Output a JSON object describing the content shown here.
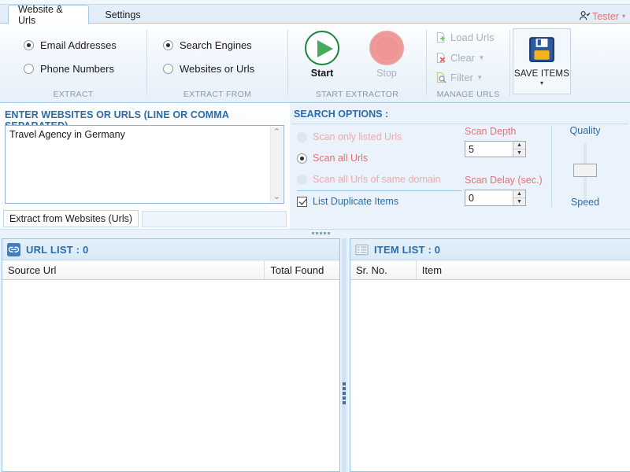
{
  "window": {
    "tabs": [
      {
        "label": "Website & Urls",
        "active": true
      },
      {
        "label": "Settings",
        "active": false
      }
    ],
    "user": {
      "name": "Tester",
      "icon": "user-check-icon",
      "caret": "▾",
      "color": "#e27272"
    }
  },
  "ribbon": {
    "groups": [
      {
        "name": "extract",
        "label": "EXTRACT",
        "options": [
          {
            "label": "Email Addresses",
            "selected": true
          },
          {
            "label": "Phone Numbers",
            "selected": false
          }
        ]
      },
      {
        "name": "extract-from",
        "label": "EXTRACT FROM",
        "options": [
          {
            "label": "Search Engines",
            "selected": true
          },
          {
            "label": "Websites or Urls",
            "selected": false
          }
        ]
      },
      {
        "name": "start-extractor",
        "label": "START EXTRACTOR",
        "buttons": [
          {
            "label": "Start",
            "icon": "play-circle-icon",
            "enabled": true
          },
          {
            "label": "Stop",
            "icon": "stop-circle-icon",
            "enabled": false
          }
        ]
      },
      {
        "name": "manage-urls",
        "label": "MANAGE URLS",
        "buttons": [
          {
            "label": "Load Urls",
            "icon": "page-plus-icon",
            "enabled": false,
            "caret": ""
          },
          {
            "label": "Clear",
            "icon": "page-x-icon",
            "enabled": false,
            "caret": "▾"
          },
          {
            "label": "Filter",
            "icon": "page-search-icon",
            "enabled": false,
            "caret": "▾"
          }
        ]
      }
    ],
    "save_items": {
      "label": "SAVE ITEMS",
      "icon": "floppy-disk-icon",
      "caret": "▾"
    }
  },
  "urls_panel": {
    "title": "ENTER WEBSITES OR URLS (LINE OR COMMA SEPARATED)",
    "textarea_value": "Travel Agency in Germany",
    "textarea_placeholder": "",
    "scroll_up": "⌃",
    "scroll_down": "⌄",
    "tab_label": "Extract from Websites (Urls)"
  },
  "search_options": {
    "title": "SEARCH OPTIONS :",
    "scan_modes": [
      {
        "label": "Scan only listed Urls",
        "selected": false,
        "enabled": false
      },
      {
        "label": "Scan all Urls",
        "selected": true,
        "enabled": true
      },
      {
        "label": "Scan all Urls of same domain",
        "selected": false,
        "enabled": false
      }
    ],
    "list_duplicate": {
      "label": "List Duplicate Items",
      "checked": true
    },
    "scan_depth": {
      "label": "Scan Depth",
      "value": "5"
    },
    "scan_delay": {
      "label": "Scan Delay (sec.)",
      "value": "0"
    },
    "slider": {
      "top_label": "Quality",
      "bottom_label": "Speed",
      "position": "middle"
    }
  },
  "url_list": {
    "header": "URL LIST : 0",
    "icon": "link-icon",
    "columns": [
      "Source Url",
      "Total Found"
    ],
    "rows": []
  },
  "item_list": {
    "header": "ITEM LIST : 0",
    "icon": "table-grid-icon",
    "columns": [
      "Sr. No.",
      "Item"
    ],
    "rows": []
  },
  "annotation": {
    "shape": "left-arrow",
    "color": "#9e2020"
  },
  "theme": {
    "accent_blue": "#2c6ca8",
    "salmon": "#e27272",
    "panel_blue": "#eaf3fb",
    "border_blue": "#9dc2e0"
  }
}
